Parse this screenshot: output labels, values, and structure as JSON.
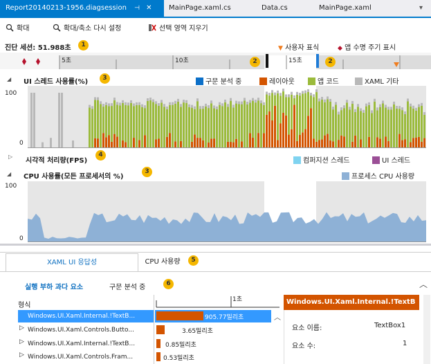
{
  "tabs": [
    {
      "label": "Report20140213-1956.diagsession",
      "active": true
    },
    {
      "label": "MainPage.xaml.cs"
    },
    {
      "label": "Data.cs"
    },
    {
      "label": "MainPage.xaml"
    }
  ],
  "tab_pin": "⊣",
  "tab_close": "✕",
  "tab_overflow": "▾",
  "toolbar": {
    "zoom": "확대",
    "reset_zoom": "확대/축소 다시 설정",
    "clear_selection": "선택 영역 지우기"
  },
  "session": {
    "label": "진단 세션: 51.988초",
    "badge": "1"
  },
  "markers": {
    "user_mark": "사용자 표식",
    "lifecycle": "앱 수명 주기 표시"
  },
  "ruler": {
    "labels": [
      "5초",
      "10초",
      "15초"
    ],
    "badge_left": "2",
    "badge_right": "2"
  },
  "ui_thread": {
    "title": "UI 스레드 사용률(%)",
    "badge": "3",
    "axis_top": "100",
    "axis_bottom": "0",
    "legend": [
      {
        "label": "구문 분석 중",
        "color": "#0b6fc8"
      },
      {
        "label": "레이아웃",
        "color": "#d35400"
      },
      {
        "label": "앱 코드",
        "color": "#9bbb3c"
      },
      {
        "label": "XAML 기타",
        "color": "#b8b8b8"
      }
    ]
  },
  "fps": {
    "title": "시각적 처리량(FPS)",
    "badge": "4",
    "legend": [
      {
        "label": "컴퍼지션 스레드",
        "color": "#7fd3f0"
      },
      {
        "label": "UI 스레드",
        "color": "#9b4f96"
      }
    ]
  },
  "cpu": {
    "title": "CPU 사용률(모든 프로세서의 %)",
    "badge": "3",
    "axis_top": "100",
    "axis_bottom": "0",
    "legend": [
      {
        "label": "프로세스 CPU 사용량",
        "color": "#8eb1d6"
      }
    ]
  },
  "bottom": {
    "tab_xaml": "XAML UI 응답성",
    "tab_cpu": "CPU 사용량",
    "tab_badge": "5",
    "sub_hot": "실행 부하 과다 요소",
    "sub_parsing": "구문 분석 중",
    "sub_badge": "6",
    "col_type": "형식",
    "scale_label": "1초",
    "rows": [
      {
        "name": "Windows.UI.Xaml.Internal.!TextB...",
        "value": "905.77밀리초",
        "frac": 1.0
      },
      {
        "name": "Windows.UI.Xaml.Controls.Butto...",
        "value": "3.65밀리초",
        "frac": 0.18
      },
      {
        "name": "Windows.UI.Xaml.Internal.!TextB...",
        "value": "0.85밀리초",
        "frac": 0.06
      },
      {
        "name": "Windows.UI.Xaml.Controls.Fram...",
        "value": "0.53밀리초",
        "frac": 0.04
      }
    ],
    "detail": {
      "title": "Windows.UI.Xaml.Internal.!TextB",
      "fields": [
        {
          "label": "요소 이름:",
          "value": "TextBox1"
        },
        {
          "label": "요소 수:",
          "value": "1"
        }
      ]
    }
  }
}
